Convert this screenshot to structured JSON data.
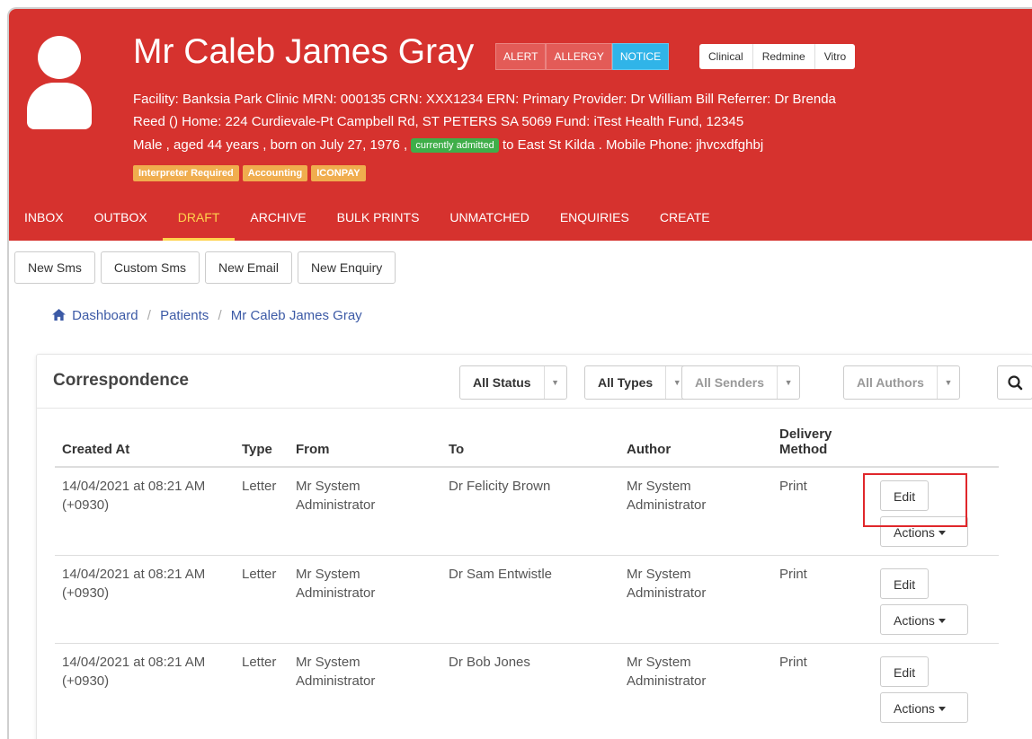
{
  "patient": {
    "name": "Mr Caleb James Gray",
    "flags": [
      "ALERT",
      "ALLERGY",
      "NOTICE"
    ],
    "links": [
      "Clinical",
      "Redmine",
      "Vitro"
    ],
    "info_line1": "Facility: Banksia Park Clinic   MRN: 000135   CRN: XXX1234   ERN:    Primary Provider: Dr William Bill   Referrer: Dr Brenda",
    "info_line2": "Reed ()   Home: 224 Curdievale-Pt Campbell Rd, ST PETERS SA 5069   Fund: iTest Health Fund, 12345",
    "info_line3_pre": "Male , aged 44 years , born on July 27, 1976 ,",
    "admitted_badge": "currently admitted",
    "info_line3_post": "to East St Kilda . Mobile Phone: jhvcxdfghbj",
    "tags": [
      "Interpreter Required",
      "Accounting",
      "ICONPAY"
    ]
  },
  "nav": {
    "tabs": [
      "INBOX",
      "OUTBOX",
      "DRAFT",
      "ARCHIVE",
      "BULK PRINTS",
      "UNMATCHED",
      "ENQUIRIES",
      "CREATE"
    ],
    "active": "DRAFT"
  },
  "toolbar": {
    "buttons": [
      "New Sms",
      "Custom Sms",
      "New Email",
      "New Enquiry"
    ]
  },
  "breadcrumb": {
    "items": [
      "Dashboard",
      "Patients",
      "Mr Caleb James Gray"
    ],
    "separator": "/"
  },
  "panel": {
    "title": "Correspondence",
    "filters": [
      "All Status",
      "All Types",
      "All Senders",
      "All Authors"
    ]
  },
  "table": {
    "headers": {
      "created_at": "Created At",
      "type": "Type",
      "from": "From",
      "to": "To",
      "author": "Author",
      "delivery_1": "Delivery",
      "delivery_2": "Method"
    },
    "rows": [
      {
        "created": "14/04/2021 at 08:21 AM",
        "tz": "(+0930)",
        "type": "Letter",
        "from_1": "Mr System",
        "from_2": "Administrator",
        "to": "Dr Felicity Brown",
        "author_1": "Mr System",
        "author_2": "Administrator",
        "delivery": "Print",
        "edit": "Edit",
        "actions": "Actions"
      },
      {
        "created": "14/04/2021 at 08:21 AM",
        "tz": "(+0930)",
        "type": "Letter",
        "from_1": "Mr System",
        "from_2": "Administrator",
        "to": "Dr Sam Entwistle",
        "author_1": "Mr System",
        "author_2": "Administrator",
        "delivery": "Print",
        "edit": "Edit",
        "actions": "Actions"
      },
      {
        "created": "14/04/2021 at 08:21 AM",
        "tz": "(+0930)",
        "type": "Letter",
        "from_1": "Mr System",
        "from_2": "Administrator",
        "to": "Dr Bob Jones",
        "author_1": "Mr System",
        "author_2": "Administrator",
        "delivery": "Print",
        "edit": "Edit",
        "actions": "Actions"
      }
    ]
  },
  "colors": {
    "header_red": "#d6322e",
    "active_tab": "#ffd24d",
    "notice_blue": "#30b4e8",
    "admitted_green": "#3fae49",
    "tag_orange": "#f0ad4e",
    "link_blue": "#3c5aa6",
    "highlight_red": "#e0272b"
  },
  "icons": [
    "avatar-icon",
    "home-icon",
    "search-icon",
    "caret-down-icon"
  ]
}
